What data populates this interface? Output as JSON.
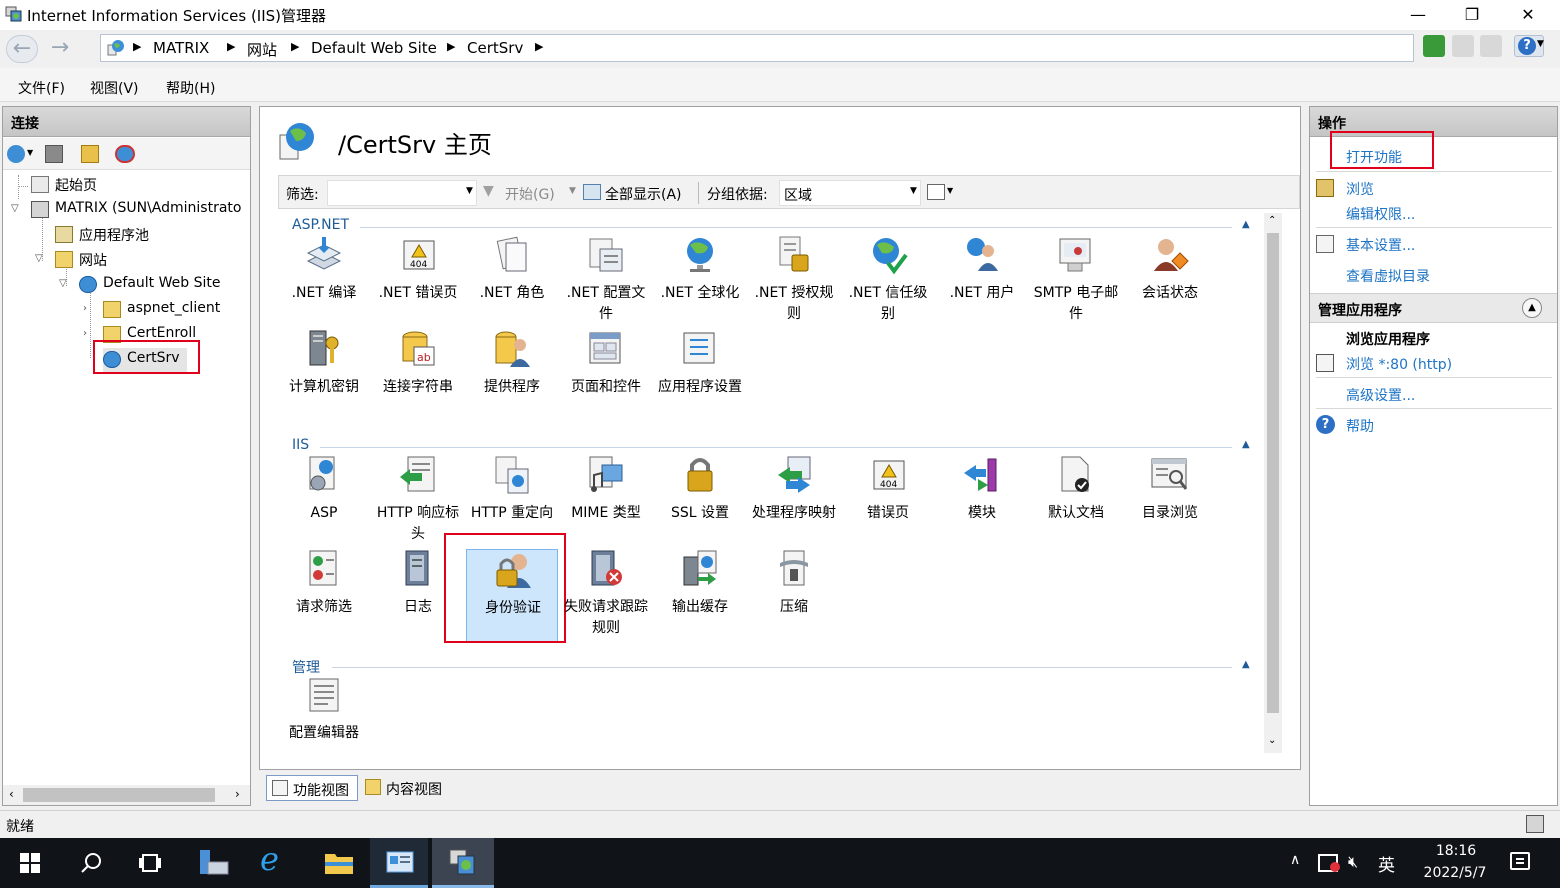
{
  "window": {
    "title": "Internet Information Services (IIS)管理器",
    "minimize": "—",
    "restore": "❐",
    "close": "✕"
  },
  "address": {
    "breadcrumbs": [
      "MATRIX",
      "网站",
      "Default Web Site",
      "CertSrv"
    ]
  },
  "menu": {
    "items": [
      "文件(F)",
      "视图(V)",
      "帮助(H)"
    ]
  },
  "connections": {
    "title": "连接",
    "tree": [
      {
        "label": "起始页"
      },
      {
        "label": "MATRIX (SUN\\Administrato"
      },
      {
        "label": "应用程序池"
      },
      {
        "label": "网站"
      },
      {
        "label": "Default Web Site"
      },
      {
        "label": "aspnet_client"
      },
      {
        "label": "CertEnroll"
      },
      {
        "label": "CertSrv"
      }
    ]
  },
  "main": {
    "title": "/CertSrv 主页",
    "filter_label": "筛选:",
    "start_label": "开始(G)",
    "show_all_label": "全部显示(A)",
    "group_by_label": "分组依据:",
    "group_by_value": "区域",
    "groups": [
      {
        "title": "ASP.NET",
        "items": [
          ".NET 编译",
          ".NET 错误页",
          ".NET 角色",
          ".NET 配置文件",
          ".NET 全球化",
          ".NET 授权规则",
          ".NET 信任级别",
          ".NET 用户",
          "SMTP 电子邮件",
          "会话状态",
          "计算机密钥",
          "连接字符串",
          "提供程序",
          "页面和控件",
          "应用程序设置"
        ]
      },
      {
        "title": "IIS",
        "items": [
          "ASP",
          "HTTP 响应标头",
          "HTTP 重定向",
          "MIME 类型",
          "SSL 设置",
          "处理程序映射",
          "错误页",
          "模块",
          "默认文档",
          "目录浏览",
          "请求筛选",
          "日志",
          "身份验证",
          "失败请求跟踪规则",
          "输出缓存",
          "压缩"
        ]
      },
      {
        "title": "管理",
        "items": [
          "配置编辑器"
        ]
      }
    ],
    "bottom_tabs": [
      "功能视图",
      "内容视图"
    ]
  },
  "actions": {
    "title": "操作",
    "open_feature": "打开功能",
    "browse": "浏览",
    "edit_permissions": "编辑权限...",
    "basic_settings": "基本设置...",
    "view_virtual_dirs": "查看虚拟目录",
    "manage_app_title": "管理应用程序",
    "browse_app_title": "浏览应用程序",
    "browse_80": "浏览 *:80 (http)",
    "advanced_settings": "高级设置...",
    "help": "帮助"
  },
  "status": {
    "text": "就绪"
  },
  "taskbar": {
    "lang": "英",
    "time": "18:16",
    "date": "2022/5/7"
  },
  "colors": {
    "link": "#1e74c6",
    "highlight_box": "#e0001b",
    "selection": "#cde6fb"
  }
}
